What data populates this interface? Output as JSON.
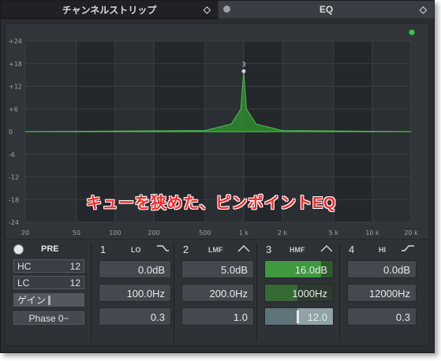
{
  "tabs": {
    "channel_strip": "チャンネルストリップ",
    "eq": "EQ"
  },
  "graph": {
    "y_labels": [
      "+24",
      "+18",
      "+12",
      "+6",
      "0",
      "-6",
      "-12",
      "-18",
      "-24"
    ],
    "x_labels": [
      "20",
      "50",
      "100",
      "200",
      "500",
      "1 k",
      "2 k",
      "5 k",
      "10 k",
      "20 k"
    ],
    "peak_label": "3",
    "status_color": "#2ecc40"
  },
  "chart_data": {
    "type": "area",
    "title": "",
    "xlabel": "",
    "ylabel": "",
    "xscale": "log",
    "xlim": [
      20,
      20000
    ],
    "ylim": [
      -24,
      24
    ],
    "series": [
      {
        "values": [
          {
            "x": 20,
            "y": 0
          },
          {
            "x": 500,
            "y": 0.3
          },
          {
            "x": 800,
            "y": 2
          },
          {
            "x": 950,
            "y": 6
          },
          {
            "x": 1000,
            "y": 16
          },
          {
            "x": 1050,
            "y": 6
          },
          {
            "x": 1250,
            "y": 2
          },
          {
            "x": 2000,
            "y": 0.3
          },
          {
            "x": 20000,
            "y": 0
          }
        ]
      }
    ],
    "grid": true
  },
  "overlay_caption": "キューを狭めた、ピンポイントEQ",
  "controls": {
    "pre_label": "PRE",
    "hc_label": "HC",
    "hc_value": "12",
    "lc_label": "LC",
    "lc_value": "12",
    "gain_label": "ゲイン",
    "phase_label": "Phase 0−",
    "bands": [
      {
        "num": "1",
        "type": "LO",
        "gain": "0.0dB",
        "freq": "100.0Hz",
        "q": "0.3",
        "shape": "lowshelf"
      },
      {
        "num": "2",
        "type": "LMF",
        "gain": "5.0dB",
        "freq": "200.0Hz",
        "q": "1.0",
        "shape": "peak"
      },
      {
        "num": "3",
        "type": "HMF",
        "gain": "16.0dB",
        "freq": "1000Hz",
        "q": "12.0",
        "shape": "peak"
      },
      {
        "num": "4",
        "type": "HI",
        "gain": "0.0dB",
        "freq": "12000Hz",
        "q": "0.3",
        "shape": "highshelf"
      }
    ],
    "active_color": "#3b9a3b"
  }
}
